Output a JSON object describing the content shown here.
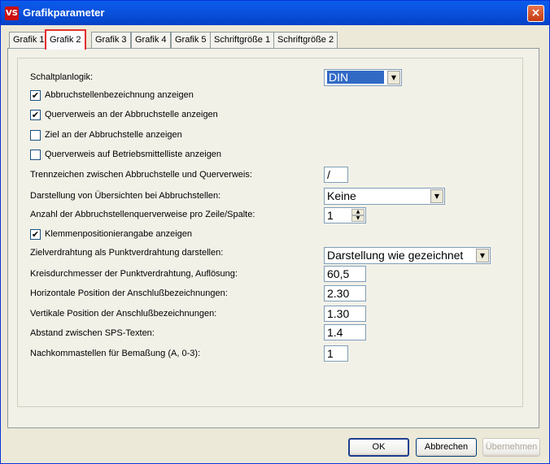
{
  "window": {
    "title": "Grafikparameter",
    "icon": "vs-app-icon",
    "close": "×"
  },
  "tabs": [
    {
      "label": "Grafik 1"
    },
    {
      "label": "Grafik 2"
    },
    {
      "label": "Grafik 3"
    },
    {
      "label": "Grafik 4"
    },
    {
      "label": "Grafik 5"
    },
    {
      "label": "Schriftgröße 1"
    },
    {
      "label": "Schriftgröße 2"
    }
  ],
  "active_tab": "Grafik 2",
  "form": {
    "schaltplanlogik_label": "Schaltplanlogik:",
    "schaltplanlogik_value": "DIN",
    "cb1_label": "Abbruchstellenbezeichnung anzeigen",
    "cb1_checked": true,
    "cb2_label": "Querverweis an der Abbruchstelle anzeigen",
    "cb2_checked": true,
    "cb3_label": "Ziel an der Abbruchstelle anzeigen",
    "cb3_checked": false,
    "cb4_label": "Querverweis auf Betriebsmittelliste anzeigen",
    "cb4_checked": false,
    "trenn_label": "Trennzeichen zwischen Abbruchstelle und Querverweis:",
    "trenn_value": "/",
    "darst_label": "Darstellung von Übersichten bei Abbruchstellen:",
    "darst_value": "Keine",
    "anzahl_label": "Anzahl der Abbruchstellenquerverweise pro Zeile/Spalte:",
    "anzahl_value": "1",
    "cb5_label": "Klemmenpositionierangabe anzeigen",
    "cb5_checked": true,
    "ziel_label": "Zielverdrahtung als Punktverdrahtung darstellen:",
    "ziel_value": "Darstellung wie gezeichnet",
    "kreis_label": "Kreisdurchmesser der Punktverdrahtung, Auflösung:",
    "kreis_value": "60,5",
    "hpos_label": "Horizontale Position der Anschlußbezeichnungen:",
    "hpos_value": "2.30",
    "vpos_label": "Vertikale Position der Anschlußbezeichnungen:",
    "vpos_value": "1.30",
    "sps_label": "Abstand zwischen SPS-Texten:",
    "sps_value": "1.4",
    "nach_label": "Nachkommastellen für Bemaßung (A, 0-3):",
    "nach_value": "1"
  },
  "buttons": {
    "ok": "OK",
    "cancel": "Abbrechen",
    "apply": "Übernehmen"
  },
  "glyphs": {
    "check": "✔",
    "down": "▼",
    "up": "▲"
  },
  "colors": {
    "titlebar": "#0a53e0",
    "selection": "#316ac5",
    "active_tab_highlight": "#e03030"
  }
}
